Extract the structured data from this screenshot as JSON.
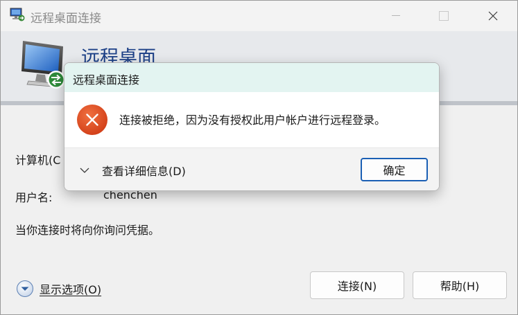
{
  "window": {
    "title": "远程桌面连接"
  },
  "banner": {
    "title": "远程桌面"
  },
  "form": {
    "computer_label": "计算机(C",
    "username_label": "用户名:",
    "username_value": "chenchen",
    "credentials_note": "当你连接时将向你询问凭据。"
  },
  "footer": {
    "show_options_label": "显示选项(O)",
    "connect_label": "连接(N)",
    "help_label": "帮助(H)"
  },
  "dialog": {
    "title": "远程桌面连接",
    "message": "连接被拒绝，因为没有授权此用户帐户进行远程登录。",
    "details_label": "查看详细信息(D)",
    "ok_label": "确定"
  },
  "colors": {
    "banner_title": "#1b3f86",
    "error_red": "#d9461c",
    "dialog_titlebar": "#e3f4f1",
    "ok_border": "#1a5fb4"
  },
  "icons": {
    "app": "remote-desktop-icon",
    "error": "error-x-icon",
    "expand": "chevron-down-icon",
    "options": "circle-chevron-down-icon"
  }
}
